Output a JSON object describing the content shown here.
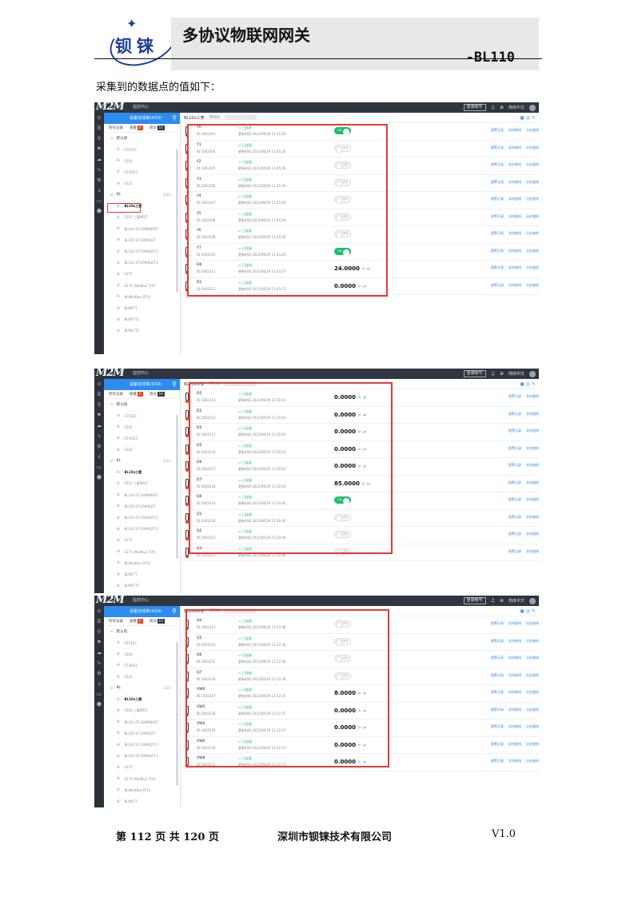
{
  "header": {
    "logo_text": "钡铼",
    "title": "多协议物联网网关",
    "model": "-BL110"
  },
  "intro": "采集到的数据点的值如下：",
  "screens": [
    {
      "brand": "M2M",
      "topnav": "监控中心",
      "tree_title": "设备在线率(4/10)",
      "tabs": {
        "all": "所有设备",
        "alarm": "报警",
        "alarm_count": "0",
        "test": "测试",
        "test_count": "10"
      },
      "groups": [
        {
          "label": "默认组",
          "count": ""
        },
        {
          "label": "BL",
          "count": "1/14"
        }
      ],
      "default_items": [
        "ST5323",
        "S326",
        "ST-R623",
        "S332"
      ],
      "bl_items": [
        "BL10x三菱",
        "S325 三菱MELT",
        "BL10x-ST-200MWAST",
        "BL102-ST-200MLDT",
        "BL102-ST-200MLDT-1",
        "BL102-ST-200MLDT-2",
        "S275",
        "S275 (Modbus TCP)",
        "BL(Modbus RTU)",
        "BLM07T",
        "BLM07T1",
        "BLM07T2"
      ],
      "active_item": "BL10x三菱",
      "device_title": "BL10x三菱",
      "sn_label": "序列号:",
      "top_buttons": {
        "exit": "登录帐号",
        "lang": "简体中文"
      },
      "rows": [
        {
          "name": "Y0",
          "id": "ID:1602203",
          "status": "已连接",
          "time": "更新时间 2021/06/29 11:45:26",
          "kind": "switch",
          "value": "ON"
        },
        {
          "name": "Y1",
          "id": "ID:1602204",
          "status": "已连接",
          "time": "更新时间 2021/06/29 11:45:26",
          "kind": "switch",
          "value": "OFF"
        },
        {
          "name": "Y2",
          "id": "ID:1602205",
          "status": "已连接",
          "time": "更新时间 2021/06/29 11:45:26",
          "kind": "switch",
          "value": "OFF"
        },
        {
          "name": "Y3",
          "id": "ID:1602206",
          "status": "已连接",
          "time": "更新时间 2021/06/29 11:45:26",
          "kind": "switch",
          "value": "OFF"
        },
        {
          "name": "Y4",
          "id": "ID:1602207",
          "status": "已连接",
          "time": "更新时间 2021/06/29 11:45:26",
          "kind": "switch",
          "value": "OFF"
        },
        {
          "name": "Y5",
          "id": "ID:1602208",
          "status": "已连接",
          "time": "更新时间 2021/06/29 11:45:26",
          "kind": "switch",
          "value": "OFF"
        },
        {
          "name": "Y6",
          "id": "ID:1602209",
          "status": "已连接",
          "time": "更新时间 2021/06/29 11:45:26",
          "kind": "switch",
          "value": "OFF"
        },
        {
          "name": "Y7",
          "id": "ID:1602210",
          "status": "已连接",
          "time": "更新时间 2021/06/29 11:45:26",
          "kind": "switch",
          "value": "ON"
        },
        {
          "name": "D0",
          "id": "ID:1602211",
          "status": "已连接",
          "time": "更新时间 2021/06/29 11:45:27",
          "kind": "number",
          "value": "24.0000"
        },
        {
          "name": "D1",
          "id": "ID:1602212",
          "status": "已连接",
          "time": "更新时间 2021/06/29 11:45:27",
          "kind": "number",
          "value": "0.0000"
        }
      ],
      "links": [
        "报警记录",
        "实时曲线",
        "历史曲线"
      ]
    },
    {
      "brand": "M2M",
      "topnav": "监控中心",
      "tree_title": "设备在线率(4/10)",
      "tabs": {
        "all": "所有设备",
        "alarm": "报警",
        "alarm_count": "0",
        "test": "测试",
        "test_count": "10"
      },
      "groups": [
        {
          "label": "默认组",
          "count": ""
        },
        {
          "label": "BL",
          "count": "1/14"
        }
      ],
      "default_items": [
        "ST5323",
        "S326",
        "ST-R623",
        "S332"
      ],
      "bl_items": [
        "BL10x三菱",
        "S325 三菱MELT",
        "BL10x-ST-200MWAST",
        "BL102-ST-200MLDT",
        "BL102-ST-200MLDT-1",
        "BL102-ST-200MLDT-2",
        "S275",
        "S275 (Modbus TCP)",
        "BL(Modbus RTU)",
        "BLM07T",
        "BLM07T1",
        "BLM07T2"
      ],
      "active_item": "BL10x三菱",
      "device_title": "BL10x三菱",
      "sn_label": "序列号:",
      "top_buttons": {
        "exit": "登录帐号",
        "lang": "简体中文"
      },
      "rows": [
        {
          "name": "D2",
          "id": "ID:1602213",
          "status": "已连接",
          "time": "更新时间 2021/06/29 11:50:41",
          "kind": "number",
          "value": "0.0000"
        },
        {
          "name": "D3",
          "id": "ID:1602214",
          "status": "已连接",
          "time": "更新时间 2021/06/29 11:50:41",
          "kind": "number",
          "value": "0.0000"
        },
        {
          "name": "D4",
          "id": "ID:1602215",
          "status": "已连接",
          "time": "更新时间 2021/06/29 11:50:41",
          "kind": "number",
          "value": "0.0000"
        },
        {
          "name": "D5",
          "id": "ID:1602216",
          "status": "已连接",
          "time": "更新时间 2021/06/29 11:50:41",
          "kind": "number",
          "value": "0.0000"
        },
        {
          "name": "D6",
          "id": "ID:1602217",
          "status": "已连接",
          "time": "更新时间 2021/06/29 11:50:41",
          "kind": "number",
          "value": "0.0000"
        },
        {
          "name": "D7",
          "id": "ID:1602218",
          "status": "已连接",
          "time": "更新时间 2021/06/29 11:50:41",
          "kind": "number",
          "value": "85.0000"
        },
        {
          "name": "Q0",
          "id": "ID:1602219",
          "status": "已连接",
          "time": "更新时间 2021/06/29 11:50:40",
          "kind": "switch",
          "value": "ON"
        },
        {
          "name": "Q1",
          "id": "ID:1602220",
          "status": "已连接",
          "time": "更新时间 2021/06/29 11:50:40",
          "kind": "switch",
          "value": "OFF"
        },
        {
          "name": "Q2",
          "id": "ID:1602221",
          "status": "已连接",
          "time": "更新时间 2021/06/29 11:50:40",
          "kind": "switch",
          "value": "OFF"
        },
        {
          "name": "Q3",
          "id": "ID:1602222",
          "status": "已连接",
          "time": "更新时间 2021/06/29 11:50:40",
          "kind": "switch",
          "value": "OFF"
        }
      ],
      "links": [
        "报警记录",
        "实时曲线"
      ]
    },
    {
      "brand": "M2M",
      "topnav": "监控中心",
      "tree_title": "设备在线率(4/10)",
      "tabs": {
        "all": "所有设备",
        "alarm": "报警",
        "alarm_count": "0",
        "test": "测试",
        "test_count": "10"
      },
      "groups": [
        {
          "label": "默认组",
          "count": ""
        },
        {
          "label": "BL",
          "count": "1/14"
        }
      ],
      "default_items": [
        "ST5323",
        "S326",
        "ST-R623",
        "S332"
      ],
      "bl_items": [
        "BL10x三菱",
        "S325 三菱MELT",
        "BL10x-ST-200MWAST",
        "BL102-ST-200MLDT",
        "BL102-ST-200MLDT-1",
        "BL102-ST-200MLDT-2",
        "S275",
        "S275 (Modbus TCP)",
        "BL(Modbus RTU)",
        "BLM07T",
        "BLM07T1",
        "BLM07T2"
      ],
      "active_item": "BL10x三菱",
      "device_title": "BL10x三菱",
      "sn_label": "序列号:",
      "top_buttons": {
        "exit": "登录帐号",
        "lang": "简体中文"
      },
      "rows": [
        {
          "name": "Q4",
          "id": "ID:1602223",
          "status": "已连接",
          "time": "更新时间 2021/06/29 11:52:36",
          "kind": "switch",
          "value": "OFF"
        },
        {
          "name": "Q5",
          "id": "ID:1602224",
          "status": "已连接",
          "time": "更新时间 2021/06/29 11:52:36",
          "kind": "switch",
          "value": "OFF"
        },
        {
          "name": "Q6",
          "id": "ID:1602225",
          "status": "已连接",
          "time": "更新时间 2021/06/29 11:52:36",
          "kind": "switch",
          "value": "OFF"
        },
        {
          "name": "Q7",
          "id": "ID:1602226",
          "status": "已连接",
          "time": "更新时间 2021/06/29 11:52:36",
          "kind": "switch",
          "value": "OFF"
        },
        {
          "name": "VW0",
          "id": "ID:1602227",
          "status": "已连接",
          "time": "更新时间 2021/06/29 11:52:37",
          "kind": "number",
          "value": "8.0000"
        },
        {
          "name": "VW2",
          "id": "ID:1602228",
          "status": "已连接",
          "time": "更新时间 2021/06/29 11:52:37",
          "kind": "number",
          "value": "0.0000"
        },
        {
          "name": "VW4",
          "id": "ID:1602229",
          "status": "已连接",
          "time": "更新时间 2021/06/29 11:52:37",
          "kind": "number",
          "value": "0.0000"
        },
        {
          "name": "VW6",
          "id": "ID:1602230",
          "status": "已连接",
          "time": "更新时间 2021/06/29 11:52:37",
          "kind": "number",
          "value": "0.0000"
        },
        {
          "name": "VW8",
          "id": "ID:1602231",
          "status": "已连接",
          "time": "更新时间 2021/06/29 11:52:37",
          "kind": "number",
          "value": "0.0000"
        }
      ],
      "links": [
        "报警记录",
        "实时曲线",
        "历史曲线"
      ]
    }
  ],
  "footer": {
    "page": "第 112 页 共 120 页",
    "company": "深圳市钡铼技术有限公司",
    "version": "V1.0"
  },
  "colors": {
    "brand_blue": "#1c3f95",
    "topbar": "#2f3640",
    "accent": "#2d8cf0",
    "online_green": "#19be6b",
    "highlight_red": "#e53935"
  }
}
